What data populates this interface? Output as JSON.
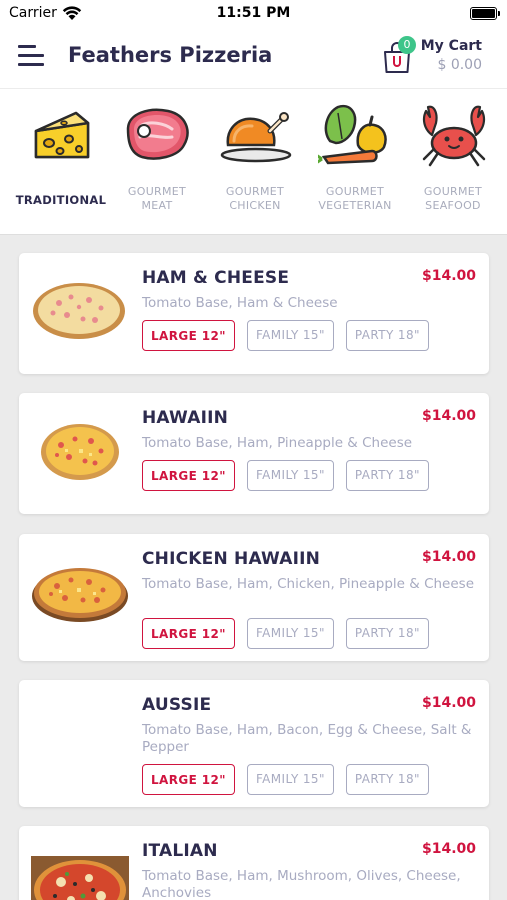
{
  "status_bar": {
    "carrier": "Carrier",
    "time": "11:51 PM"
  },
  "header": {
    "title": "Feathers Pizzeria",
    "cart_label": "My Cart",
    "cart_total": "$ 0.00",
    "cart_count": "0"
  },
  "categories": [
    {
      "label": "TRADITIONAL",
      "icon": "cheese-icon",
      "active": true
    },
    {
      "label": "GOURMET MEAT",
      "icon": "steak-icon",
      "active": false
    },
    {
      "label": "GOURMET CHICKEN",
      "icon": "roast-chicken-icon",
      "active": false
    },
    {
      "label": "GOURMET VEGETERIAN",
      "icon": "vegetables-icon",
      "active": false
    },
    {
      "label": "GOURMET SEAFOOD",
      "icon": "crab-icon",
      "active": false
    }
  ],
  "products": [
    {
      "name": "HAM & CHEESE",
      "price": "$14.00",
      "description": "Tomato Base, Ham & Cheese",
      "image": "ham-cheese-pizza-image"
    },
    {
      "name": "HAWAIIN",
      "price": "$14.00",
      "description": "Tomato Base, Ham, Pineapple & Cheese",
      "image": "hawaiin-pizza-image"
    },
    {
      "name": "CHICKEN HAWAIIN",
      "price": "$14.00",
      "description": "Tomato Base, Ham, Chicken, Pineapple & Cheese",
      "image": "chicken-hawaiin-pizza-image"
    },
    {
      "name": "AUSSIE",
      "price": "$14.00",
      "description": "Tomato Base, Ham, Bacon, Egg & Cheese, Salt & Pepper",
      "image": ""
    },
    {
      "name": "ITALIAN",
      "price": "$14.00",
      "description": "Tomato Base, Ham, Mushroom, Olives, Cheese, Anchovies",
      "image": "italian-pizza-image"
    }
  ],
  "sizes": [
    "LARGE 12\"",
    "FAMILY 15\"",
    "PARTY 18\""
  ],
  "selected_size": "LARGE 12\"",
  "colors": {
    "accent": "#d0143f",
    "badge": "#3ec58a",
    "text_dark": "#2d2b4e",
    "text_muted": "#a8abc1"
  }
}
